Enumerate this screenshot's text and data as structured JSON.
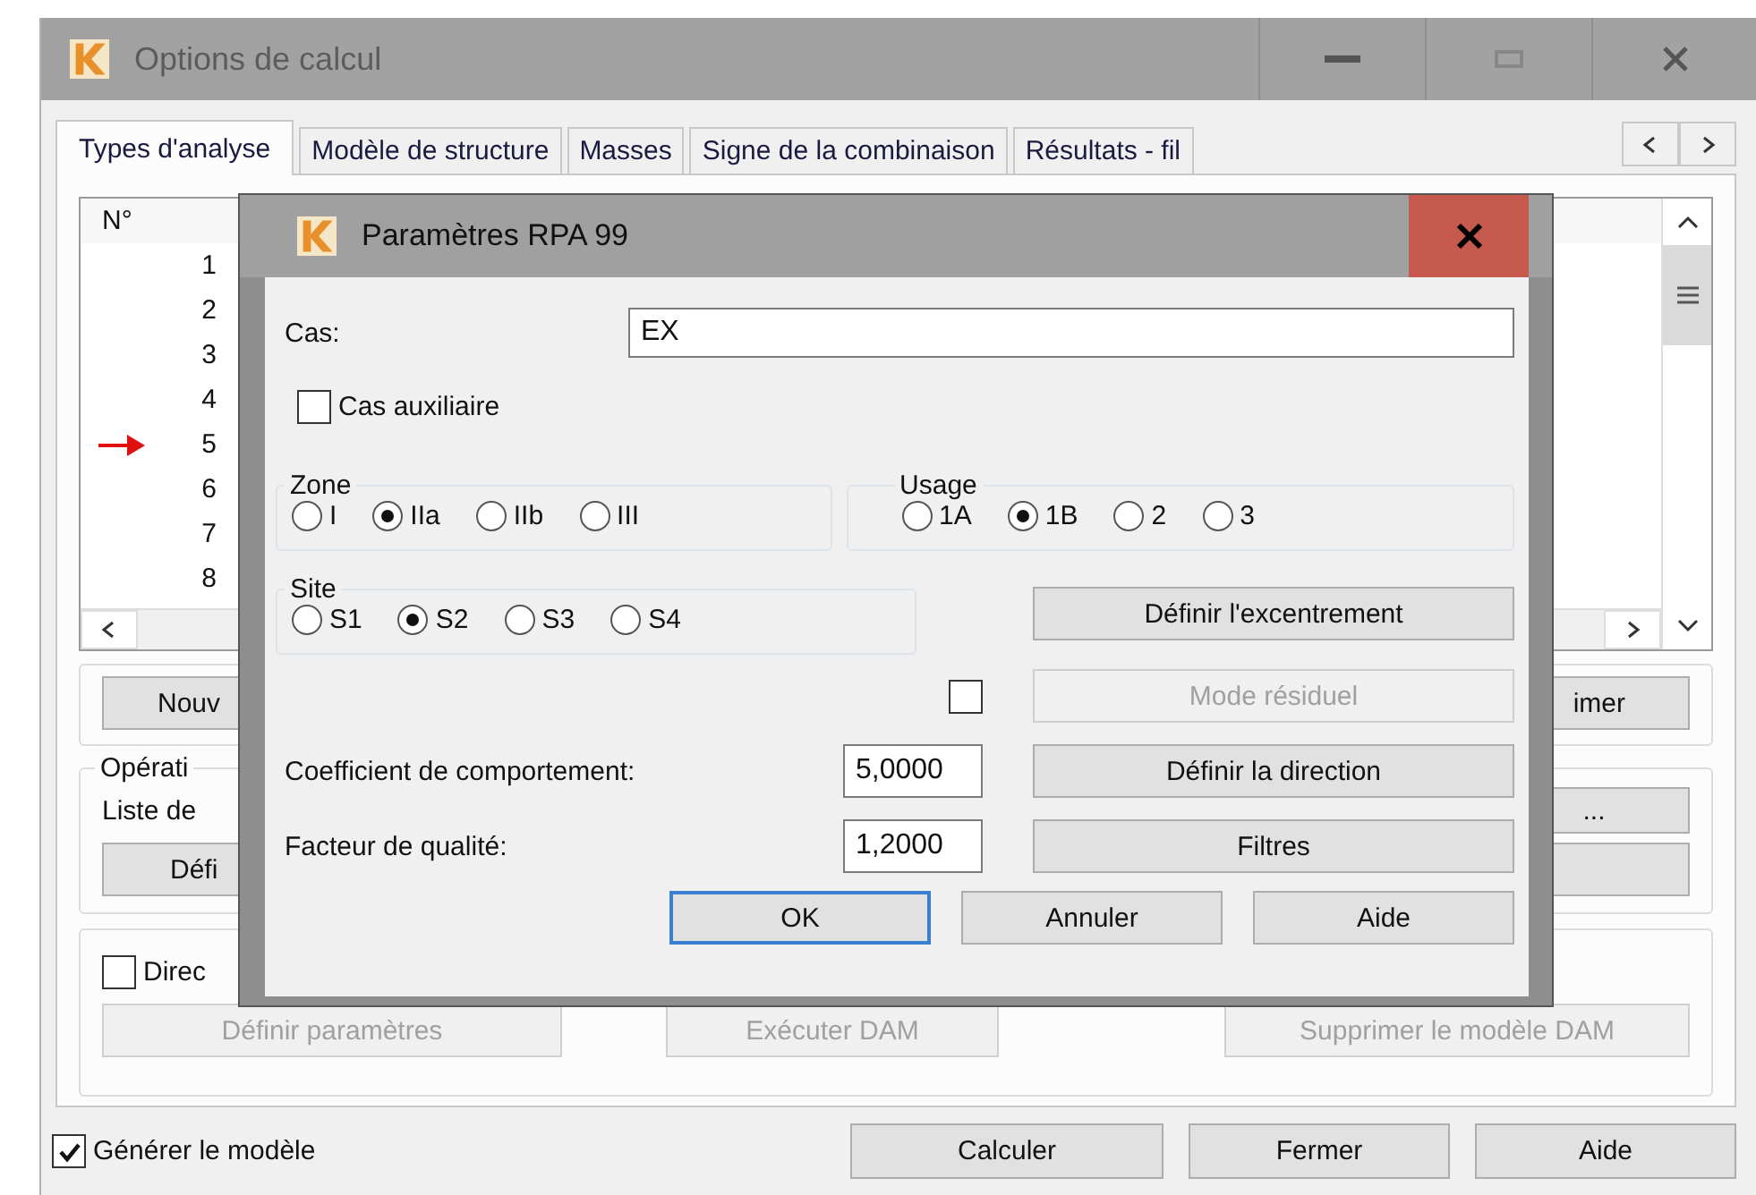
{
  "window": {
    "title": "Options de calcul"
  },
  "tabs": [
    {
      "label": "Types d'analyse",
      "selected": true
    },
    {
      "label": "Modèle de structure",
      "selected": false
    },
    {
      "label": "Masses",
      "selected": false
    },
    {
      "label": "Signe de la combinaison",
      "selected": false
    },
    {
      "label": "Résultats - fil",
      "selected": false
    }
  ],
  "list": {
    "header": "N°",
    "rows": [
      {
        "number": "1",
        "marked": false
      },
      {
        "number": "2",
        "marked": false
      },
      {
        "number": "3",
        "marked": false
      },
      {
        "number": "4",
        "marked": false
      },
      {
        "number": "5",
        "marked": true
      },
      {
        "number": "6",
        "marked": false
      },
      {
        "number": "7",
        "marked": false
      },
      {
        "number": "8",
        "marked": false
      }
    ]
  },
  "actions": {
    "left_button": "Nouv",
    "right_button": "imer"
  },
  "operations": {
    "legend": "Opérati",
    "label": "Liste de",
    "more_button": "...",
    "left_button": "Défi"
  },
  "dam": {
    "checkbox": {
      "label": "Direc",
      "checked": false
    },
    "buttons": [
      {
        "label": "Définir paramètres",
        "disabled": true
      },
      {
        "label": "Exécuter DAM",
        "disabled": true
      },
      {
        "label": "Supprimer le modèle DAM",
        "disabled": true
      }
    ]
  },
  "footer": {
    "checkbox": {
      "label": "Générer le modèle",
      "checked": true
    },
    "buttons": [
      "Calculer",
      "Fermer",
      "Aide"
    ]
  },
  "dialog": {
    "title": "Paramètres RPA 99",
    "case_label": "Cas:",
    "case_value": "EX",
    "auxiliary": {
      "label": "Cas auxiliaire",
      "checked": false
    },
    "zone": {
      "legend": "Zone",
      "options": [
        {
          "label": "I",
          "selected": false
        },
        {
          "label": "IIa",
          "selected": true
        },
        {
          "label": "IIb",
          "selected": false
        },
        {
          "label": "III",
          "selected": false
        }
      ]
    },
    "usage": {
      "legend": "Usage",
      "options": [
        {
          "label": "1A",
          "selected": false
        },
        {
          "label": "1B",
          "selected": true
        },
        {
          "label": "2",
          "selected": false
        },
        {
          "label": "3",
          "selected": false
        }
      ]
    },
    "site": {
      "legend": "Site",
      "options": [
        {
          "label": "S1",
          "selected": false
        },
        {
          "label": "S2",
          "selected": true
        },
        {
          "label": "S3",
          "selected": false
        },
        {
          "label": "S4",
          "selected": false
        }
      ]
    },
    "side_buttons": [
      {
        "label": "Définir l'excentrement",
        "disabled": false
      },
      {
        "label": "Mode résiduel",
        "disabled": true
      },
      {
        "label": "Définir la direction",
        "disabled": false
      },
      {
        "label": "Filtres",
        "disabled": false
      }
    ],
    "residual": {
      "checked": false
    },
    "fields": [
      {
        "label": "Coefficient de comportement:",
        "value": "5,0000"
      },
      {
        "label": "Facteur de qualité:",
        "value": "1,2000"
      }
    ],
    "buttons": [
      {
        "label": "OK",
        "focused": true
      },
      {
        "label": "Annuler",
        "focused": false
      },
      {
        "label": "Aide",
        "focused": false
      }
    ]
  }
}
